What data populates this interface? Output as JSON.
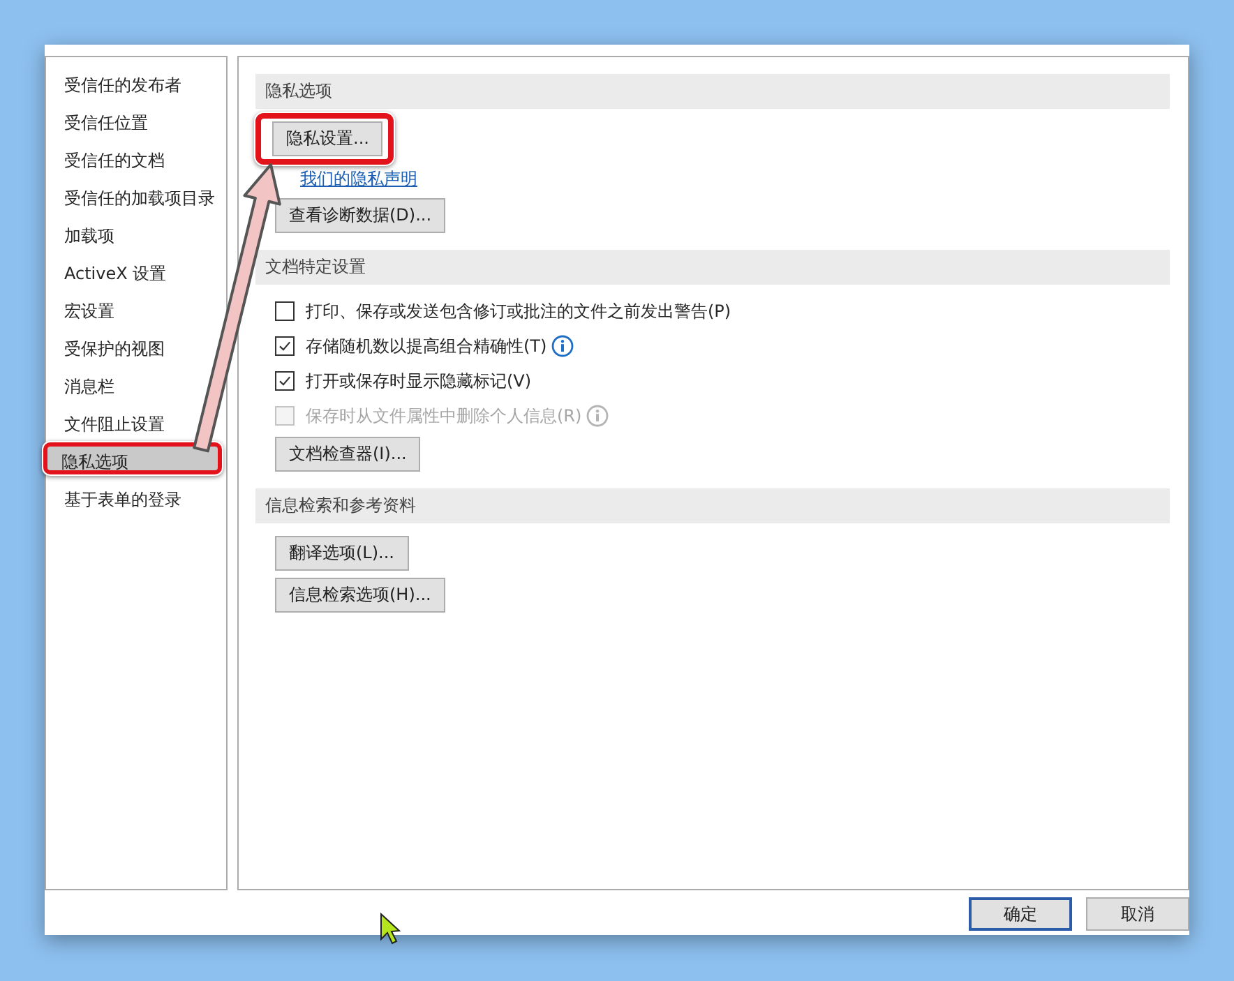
{
  "sidebar": {
    "items": [
      {
        "label": "受信任的发布者",
        "selected": false,
        "highlighted": false
      },
      {
        "label": "受信任位置",
        "selected": false,
        "highlighted": false
      },
      {
        "label": "受信任的文档",
        "selected": false,
        "highlighted": false
      },
      {
        "label": "受信任的加载项目录",
        "selected": false,
        "highlighted": false
      },
      {
        "label": "加载项",
        "selected": false,
        "highlighted": false
      },
      {
        "label": "ActiveX 设置",
        "selected": false,
        "highlighted": false
      },
      {
        "label": "宏设置",
        "selected": false,
        "highlighted": false
      },
      {
        "label": "受保护的视图",
        "selected": false,
        "highlighted": false
      },
      {
        "label": "消息栏",
        "selected": false,
        "highlighted": false
      },
      {
        "label": "文件阻止设置",
        "selected": false,
        "highlighted": false
      },
      {
        "label": "隐私选项",
        "selected": true,
        "highlighted": true
      },
      {
        "label": "基于表单的登录",
        "selected": false,
        "highlighted": false
      }
    ]
  },
  "sections": [
    {
      "title": "隐私选项",
      "controls": [
        {
          "kind": "button",
          "label": "隐私设置...",
          "highlighted": true
        },
        {
          "kind": "link",
          "label": "我们的隐私声明"
        },
        {
          "kind": "button",
          "label": "查看诊断数据(D)...",
          "highlighted": false
        }
      ]
    },
    {
      "title": "文档特定设置",
      "controls": [
        {
          "kind": "checkbox",
          "label": "打印、保存或发送包含修订或批注的文件之前发出警告(P)",
          "checked": false,
          "disabled": false,
          "info": false
        },
        {
          "kind": "checkbox",
          "label": "存储随机数以提高组合精确性(T)",
          "checked": true,
          "disabled": false,
          "info": true
        },
        {
          "kind": "checkbox",
          "label": "打开或保存时显示隐藏标记(V)",
          "checked": true,
          "disabled": false,
          "info": false
        },
        {
          "kind": "checkbox",
          "label": "保存时从文件属性中删除个人信息(R)",
          "checked": false,
          "disabled": true,
          "info": true
        },
        {
          "kind": "button",
          "label": "文档检查器(I)...",
          "highlighted": false
        }
      ]
    },
    {
      "title": "信息检索和参考资料",
      "controls": [
        {
          "kind": "button",
          "label": "翻译选项(L)...",
          "highlighted": false
        },
        {
          "kind": "button",
          "label": "信息检索选项(H)...",
          "highlighted": false
        }
      ]
    }
  ],
  "footer": {
    "buttons": [
      {
        "label": "确定",
        "default": true
      },
      {
        "label": "取消",
        "default": false
      }
    ]
  },
  "callout_arrow": true,
  "mouse_cursor": true
}
